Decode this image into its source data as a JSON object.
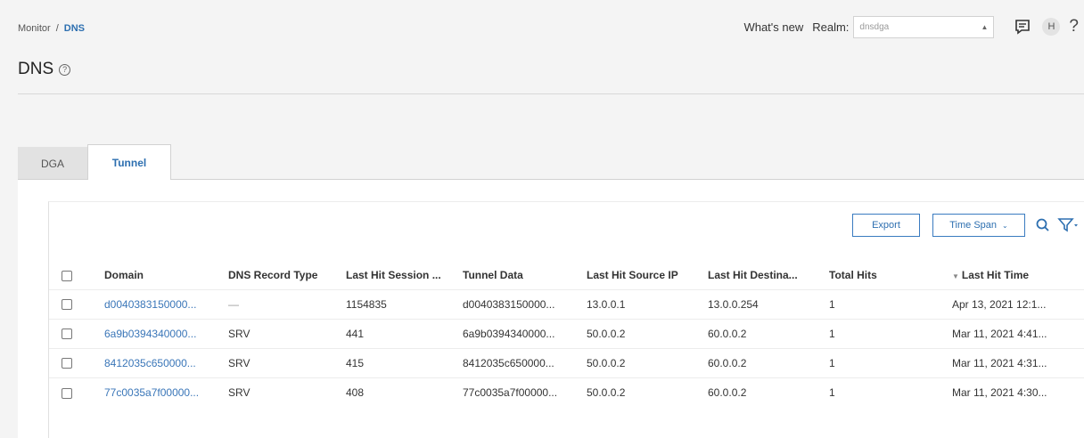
{
  "breadcrumb": {
    "root": "Monitor",
    "separator": "/",
    "current": "DNS"
  },
  "page": {
    "title": "DNS",
    "help_glyph": "?"
  },
  "header": {
    "whats_new": "What's new",
    "realm_label": "Realm:",
    "realm_value": "dnsdga",
    "avatar_initial": "H",
    "help": "?"
  },
  "tabs": [
    {
      "label": "DGA",
      "active": false
    },
    {
      "label": "Tunnel",
      "active": true
    }
  ],
  "toolbar": {
    "export_label": "Export",
    "timespan_label": "Time Span"
  },
  "table": {
    "columns": [
      "Domain",
      "DNS Record Type",
      "Last Hit Session ...",
      "Tunnel Data",
      "Last Hit Source IP",
      "Last Hit Destina...",
      "Total Hits",
      "Last Hit Time"
    ],
    "rows": [
      [
        "d0040383150000...",
        "—",
        "1154835",
        "d0040383150000...",
        "13.0.0.1",
        "13.0.0.254",
        "1",
        "Apr 13, 2021 12:1..."
      ],
      [
        "6a9b0394340000...",
        "SRV",
        "441",
        "6a9b0394340000...",
        "50.0.0.2",
        "60.0.0.2",
        "1",
        "Mar 11, 2021 4:41..."
      ],
      [
        "8412035c650000...",
        "SRV",
        "415",
        "8412035c650000...",
        "50.0.0.2",
        "60.0.0.2",
        "1",
        "Mar 11, 2021 4:31..."
      ],
      [
        "77c0035a7f00000...",
        "SRV",
        "408",
        "77c0035a7f00000...",
        "50.0.0.2",
        "60.0.0.2",
        "1",
        "Mar 11, 2021 4:30..."
      ]
    ]
  },
  "colors": {
    "accent": "#2d6fb0",
    "link": "#3a76b8",
    "background": "#f4f4f4"
  }
}
